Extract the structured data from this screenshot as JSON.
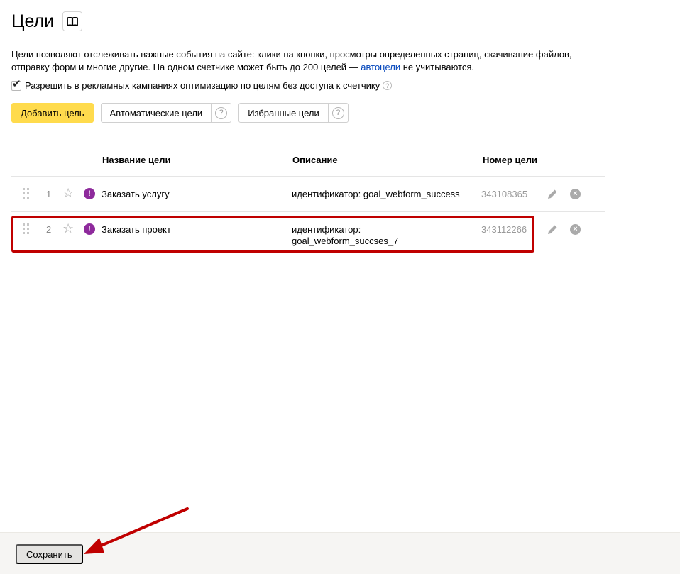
{
  "header": {
    "title": "Цели",
    "book_icon": "book-icon"
  },
  "description": {
    "text_before_link": "Цели позволяют отслеживать важные события на сайте: клики на кнопки, просмотры определенных страниц, скачивание файлов, отправку форм и многие другие. На одном счетчике может быть до 200 целей — ",
    "link": "автоцели",
    "text_after_link": " не учитываются."
  },
  "option": {
    "checked": true,
    "label": "Разрешить в рекламных кампаниях оптимизацию по целям без доступа к счетчику",
    "help": "?"
  },
  "toolbar": {
    "add_label": "Добавить цель",
    "auto_label": "Автоматические цели",
    "favorites_label": "Избранные цели",
    "help": "?"
  },
  "table": {
    "columns": [
      "Название цели",
      "Описание",
      "Номер цели"
    ],
    "rows": [
      {
        "num": "1",
        "name": "Заказать услугу",
        "description": "идентификатор: goal_webform_success",
        "goal_id": "343108365"
      },
      {
        "num": "2",
        "name": "Заказать проект",
        "description": "идентификатор: goal_webform_succses_7",
        "goal_id": "343112266"
      }
    ]
  },
  "icons": {
    "warn": "!",
    "close": "×",
    "star": "☆"
  },
  "footer": {
    "save_label": "Сохранить"
  },
  "colors": {
    "accent_yellow": "#ffdb4d",
    "warning_purple": "#8e2a9c",
    "annotation_red": "#c00000",
    "link_blue": "#0044bb"
  }
}
